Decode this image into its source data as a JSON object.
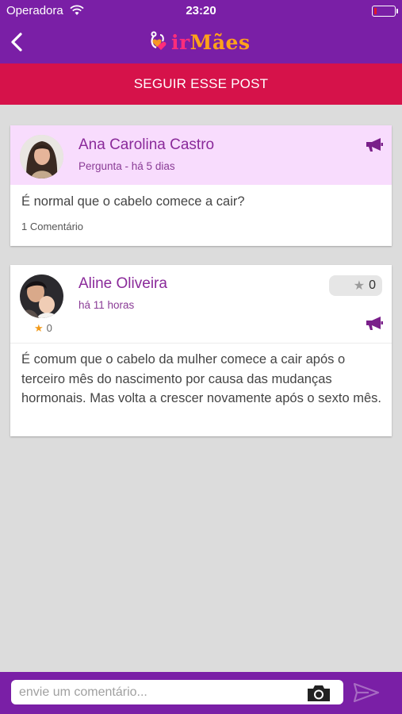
{
  "status_bar": {
    "carrier": "Operadora",
    "time": "23:20"
  },
  "nav": {
    "back_icon": "chevron-left-icon",
    "logo": {
      "part1": "ir",
      "part2": "Mães"
    }
  },
  "follow_button": {
    "label": "SEGUIR ESSE POST"
  },
  "question": {
    "author": "Ana Carolina Castro",
    "meta": "Pergunta - há 5 dias",
    "text": "É normal que o cabelo comece a cair?",
    "comments_count": "1 Comentário",
    "report_icon": "megaphone-icon"
  },
  "answer": {
    "author": "Aline Oliveira",
    "meta": "há 11 horas",
    "likes": "0",
    "author_score": "0",
    "text": "É comum que o cabelo da mulher comece a cair após o terceiro mês do nascimento por causa das mudanças hormonais. Mas volta a crescer novamente após o sexto mês.",
    "report_icon": "megaphone-icon"
  },
  "comment_bar": {
    "placeholder": "envie um comentário...",
    "camera_icon": "camera-icon",
    "send_icon": "send-icon"
  },
  "colors": {
    "primary_purple": "#7a1fa6",
    "follow_red": "#d6124a",
    "question_bg": "#f8dcfd",
    "name_purple": "#8a2a9a",
    "logo_pink": "#ff2d7a",
    "logo_orange": "#ffa21a"
  }
}
